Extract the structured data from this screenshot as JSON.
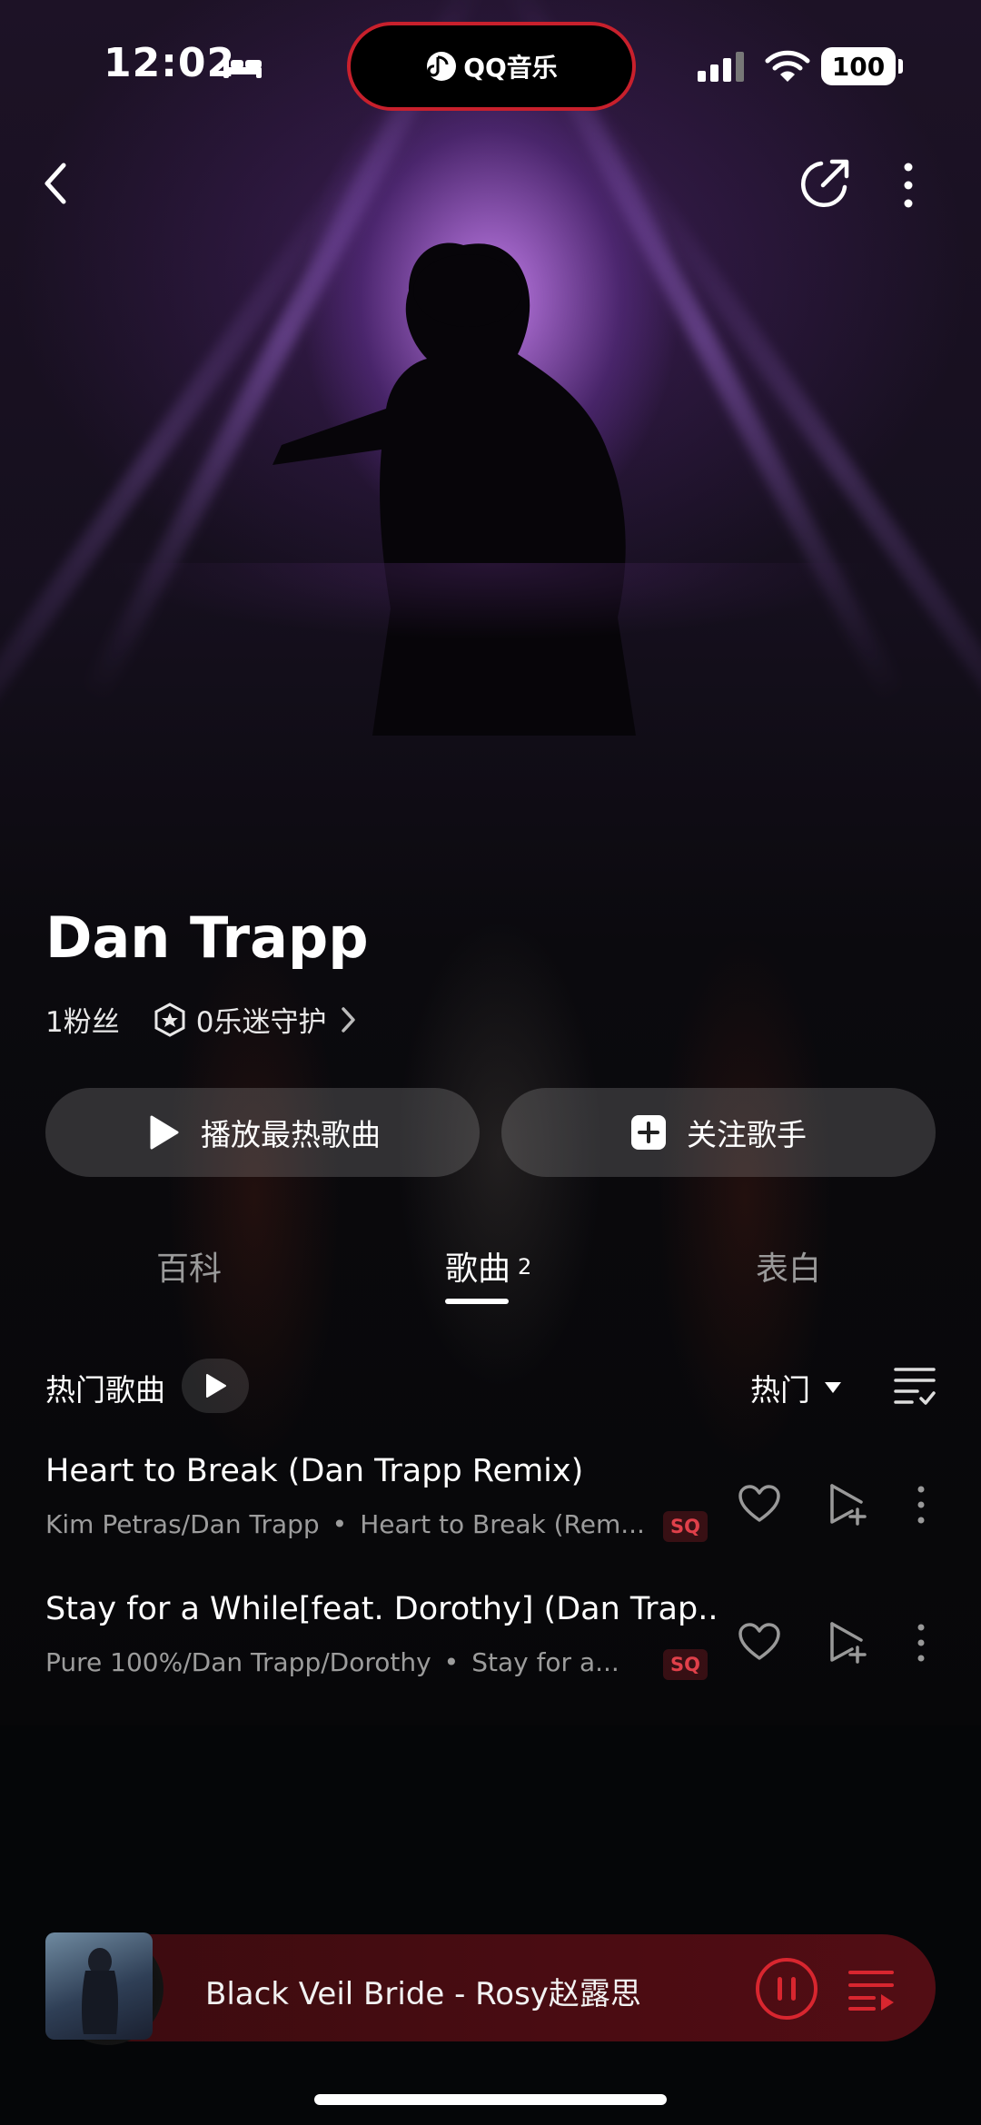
{
  "status_bar": {
    "time": "12:02",
    "island_app": "QQ音乐",
    "battery": "100"
  },
  "artist": {
    "name": "Dan Trapp",
    "fans": "1粉丝",
    "guard": "0乐迷守护"
  },
  "actions": {
    "play_label": "播放最热歌曲",
    "follow_label": "关注歌手"
  },
  "tabs": [
    {
      "label": "百科",
      "count": ""
    },
    {
      "label": "歌曲",
      "count": "2"
    },
    {
      "label": "表白",
      "count": ""
    }
  ],
  "list_header": {
    "title": "热门歌曲",
    "sort_label": "热门"
  },
  "songs": [
    {
      "title": "Heart to Break (Dan Trapp Remix)",
      "artists": "Kim Petras/Dan Trapp",
      "album": "Heart to Break (Rem...",
      "quality": "SQ"
    },
    {
      "title": "Stay for a While[feat. Dorothy] (Dan Trap...",
      "artists": "Pure 100%/Dan Trapp/Dorothy",
      "album": "Stay for a...",
      "quality": "SQ"
    }
  ],
  "now_playing": {
    "title": "Black Veil Bride - Rosy赵露思"
  },
  "colors": {
    "accent_red": "#c8202c",
    "sq_badge": "#e0404a",
    "mini_player_bg": "#4a0c12"
  },
  "icons": [
    "sleep-icon",
    "signal-icon",
    "wifi-icon",
    "back-icon",
    "share-icon",
    "more-icon",
    "guard-icon",
    "chevron-right-icon",
    "play-icon",
    "plus-icon",
    "caret-down-icon",
    "manage-list-icon",
    "heart-icon",
    "add-to-playlist-icon",
    "more-vertical-icon",
    "pause-icon",
    "queue-icon"
  ]
}
